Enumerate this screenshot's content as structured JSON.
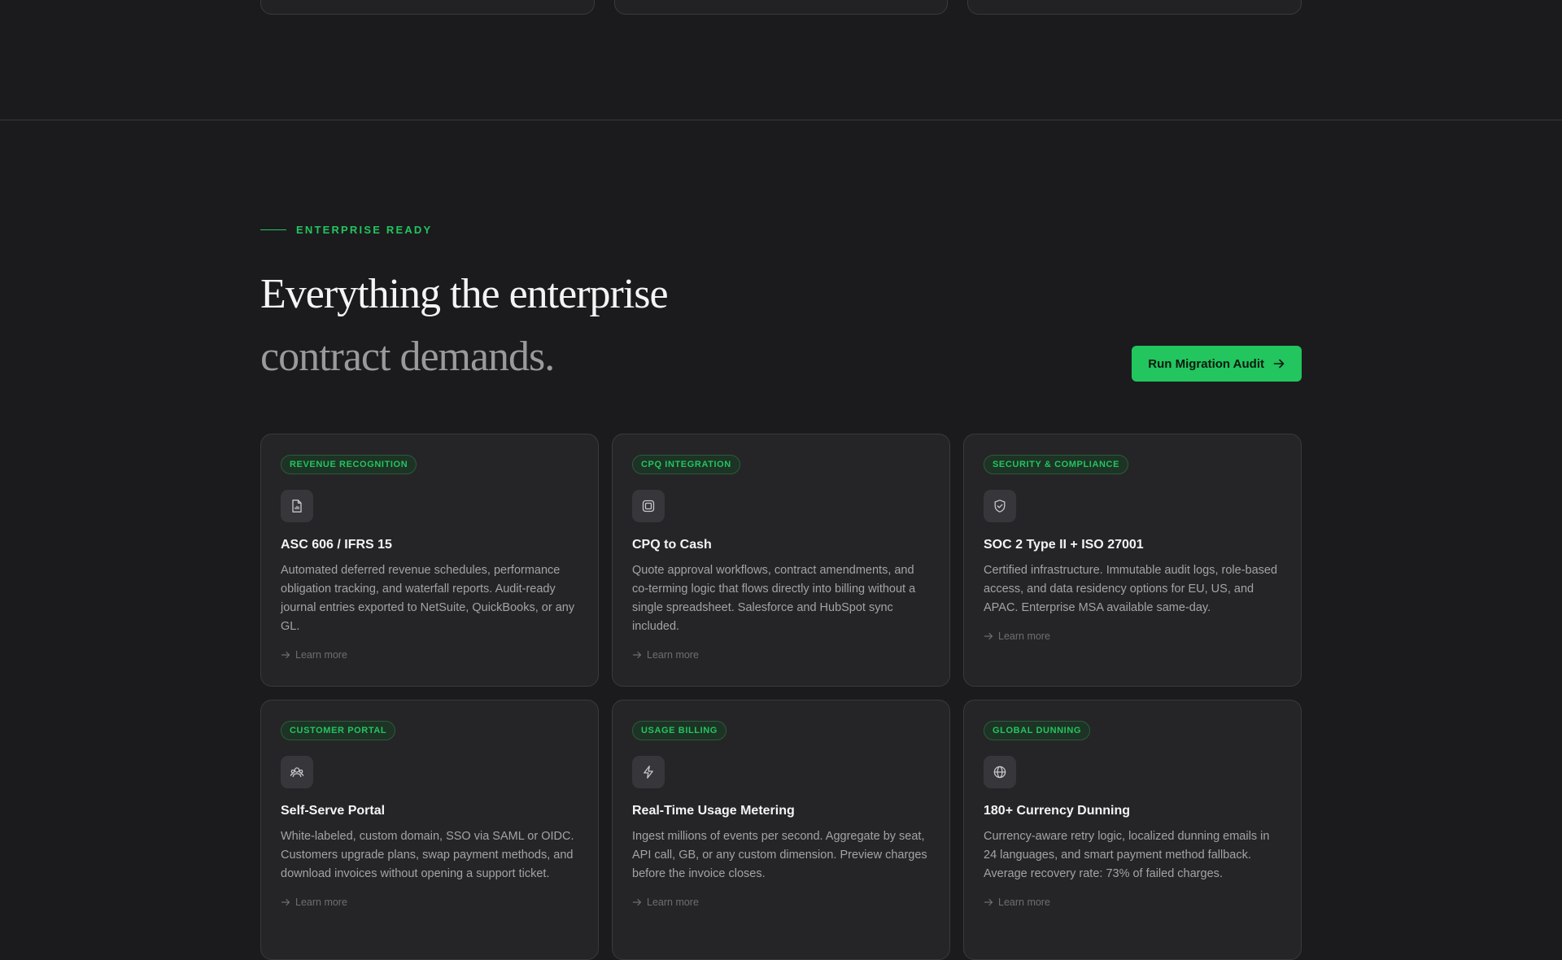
{
  "eyebrow": "ENTERPRISE READY",
  "headline": {
    "line1": "Everything the enterprise",
    "line2": "contract demands."
  },
  "cta": {
    "label": "Run Migration Audit"
  },
  "accent_color": "#22c55e",
  "cards": [
    {
      "badge": "REVENUE RECOGNITION",
      "icon": "document-icon",
      "title": "ASC 606 / IFRS 15",
      "description": "Automated deferred revenue schedules, performance obligation tracking, and waterfall reports. Audit-ready journal entries exported to NetSuite, QuickBooks, or any GL.",
      "link": "Learn more"
    },
    {
      "badge": "CPQ INTEGRATION",
      "icon": "chip-icon",
      "title": "CPQ to Cash",
      "description": "Quote approval workflows, contract amendments, and co-terming logic that flows directly into billing without a single spreadsheet. Salesforce and HubSpot sync included.",
      "link": "Learn more"
    },
    {
      "badge": "SECURITY & COMPLIANCE",
      "icon": "shield-check-icon",
      "title": "SOC 2 Type II + ISO 27001",
      "description": "Certified infrastructure. Immutable audit logs, role-based access, and data residency options for EU, US, and APAC. Enterprise MSA available same-day.",
      "link": "Learn more"
    },
    {
      "badge": "CUSTOMER PORTAL",
      "icon": "users-icon",
      "title": "Self-Serve Portal",
      "description": "White-labeled, custom domain, SSO via SAML or OIDC. Customers upgrade plans, swap payment methods, and download invoices without opening a support ticket.",
      "link": "Learn more"
    },
    {
      "badge": "USAGE BILLING",
      "icon": "lightning-icon",
      "title": "Real-Time Usage Metering",
      "description": "Ingest millions of events per second. Aggregate by seat, API call, GB, or any custom dimension. Preview charges before the invoice closes.",
      "link": "Learn more"
    },
    {
      "badge": "GLOBAL DUNNING",
      "icon": "globe-icon",
      "title": "180+ Currency Dunning",
      "description": "Currency-aware retry logic, localized dunning emails in 24 languages, and smart payment method fallback. Average recovery rate: 73% of failed charges.",
      "link": "Learn more"
    }
  ]
}
